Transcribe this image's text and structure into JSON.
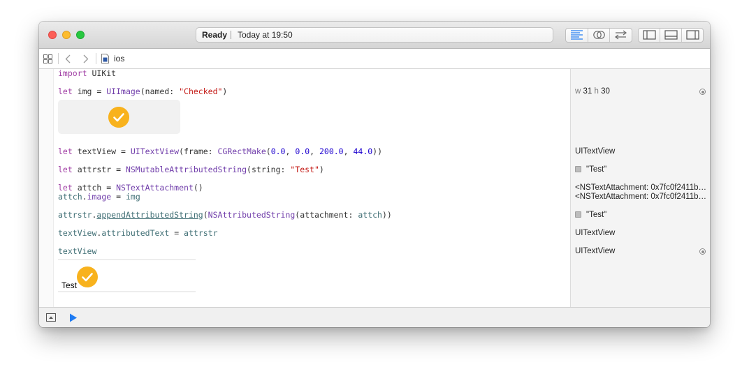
{
  "window": {
    "status_ready": "Ready",
    "status_time": "Today at 19:50",
    "breadcrumb": "ios"
  },
  "code_lines": {
    "l1": {
      "kw": "import",
      "rest": " UIKit"
    },
    "l2": {
      "kw": "let",
      "var": " img = ",
      "type": "UIImage",
      "a": "(named: ",
      "str": "\"Checked\"",
      "b": ")"
    },
    "l3": {
      "kw": "let",
      "var": " textView = ",
      "type": "UITextView",
      "a": "(frame: ",
      "fn": "CGRectMake",
      "b": "(",
      "n1": "0.0",
      "c1": ", ",
      "n2": "0.0",
      "c2": ", ",
      "n3": "200.0",
      "c3": ", ",
      "n4": "44.0",
      "d": "))"
    },
    "l4": {
      "kw": "let",
      "var": " attrstr = ",
      "type": "NSMutableAttributedString",
      "a": "(string: ",
      "str": "\"Test\"",
      "b": ")"
    },
    "l5": {
      "kw": "let",
      "var": " attch = ",
      "type": "NSTextAttachment",
      "a": "()"
    },
    "l6": {
      "obj": "attch",
      "dot": ".",
      "prop": "image",
      "eq": " = ",
      "val": "img"
    },
    "l7": {
      "obj": "attrstr",
      "dot": ".",
      "method": "appendAttributedString",
      "a": "(",
      "type": "NSAttributedString",
      "b": "(attachment: ",
      "arg": "attch",
      "c": "))"
    },
    "l8": {
      "obj": "textView",
      "dot": ".",
      "prop": "attributedText",
      "eq": " = ",
      "val": "attrstr"
    },
    "l9": {
      "obj": "textView"
    }
  },
  "results": {
    "r_img_w_label": "w",
    "r_img_w": "31",
    "r_img_h_label": "h",
    "r_img_h": "30",
    "r_textview": "UITextView",
    "r_attrstr": "\"Test\"",
    "r_attch1": "<NSTextAttachment: 0x7fc0f2411b6…",
    "r_attch2": "<NSTextAttachment: 0x7fc0f2411b6…",
    "r_append": "\"Test\"",
    "r_assign": "UITextView",
    "r_textview2": "UITextView"
  },
  "preview": {
    "textview_text": "Test"
  },
  "colors": {
    "keyword": "#a03ea4",
    "type": "#703daa",
    "string": "#c41a16",
    "number": "#1c00cf",
    "property": "#3f6e74",
    "checkmark": "#f8b21d",
    "run": "#1f7bf2"
  },
  "icons": {
    "toolbar": [
      "standard-editor-icon",
      "assistant-editor-icon",
      "version-editor-icon",
      "navigator-toggle-icon",
      "debug-area-toggle-icon",
      "utilities-toggle-icon"
    ],
    "nav": [
      "related-items-icon",
      "back-icon",
      "forward-icon",
      "playground-file-icon"
    ],
    "bottom": [
      "hide-debug-area-icon",
      "run-icon"
    ]
  }
}
